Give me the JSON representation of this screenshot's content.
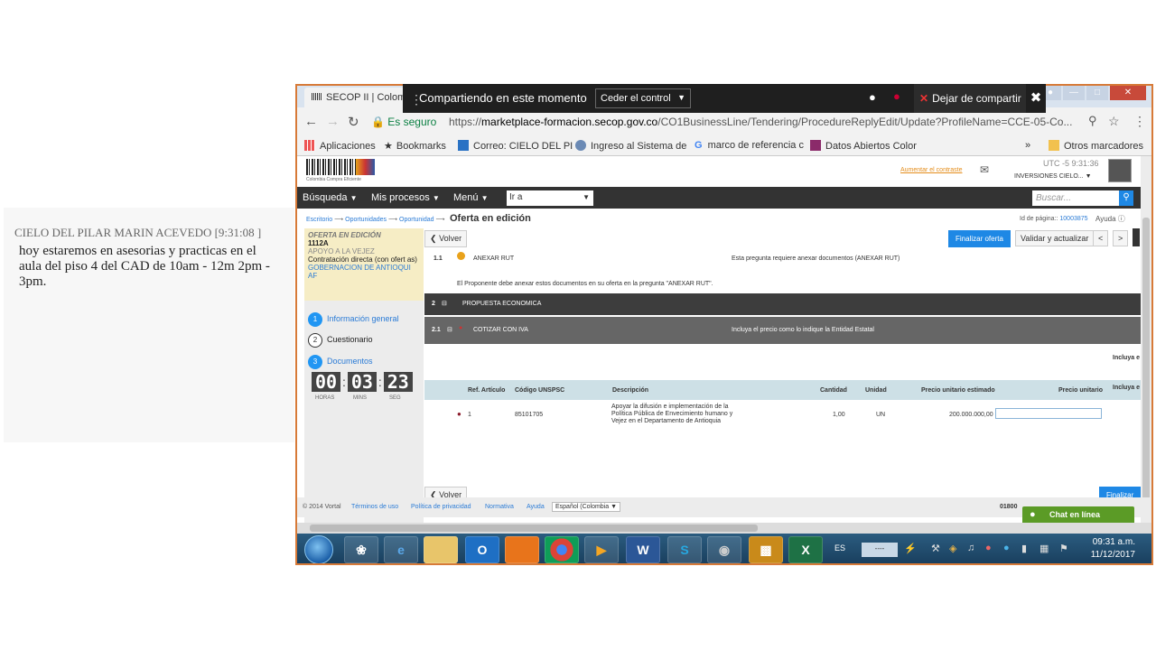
{
  "chat": {
    "sender": "CIELO DEL PILAR MARIN ACEVEDO [9:31:08 ]",
    "message": "hoy  estaremos en asesorias y practicas en el aula del piso 4 del CAD de 10am - 12m 2pm - 3pm."
  },
  "browser": {
    "tab_title": "SECOP II | Colomb",
    "secure_label": "Es seguro",
    "url_prefix": "https://",
    "url_domain": "marketplace-formacion.secop.gov.co",
    "url_path": "/CO1BusinessLine/Tendering/ProcedureReplyEdit/Update?ProfileName=CCE-05-Co...",
    "bookmarks": [
      "Aplicaciones",
      "Bookmarks",
      "Correo: CIELO DEL PI",
      "Ingreso al Sistema de",
      "marco de referencia c",
      "Datos Abiertos Color",
      "»",
      "Otros marcadores"
    ]
  },
  "sharebar": {
    "status": "Compartiendo en este momento",
    "control_option": "Ceder el control",
    "stop_label": "Dejar de compartir"
  },
  "header": {
    "brand_text": "Colombia Compra Eficiente",
    "contrast_link": "Aumentar el contraste",
    "utc": "UTC -5 9:31:36",
    "company": "INVERSIONES CIELO...",
    "menu": [
      "Búsqueda",
      "Mis procesos",
      "Menú"
    ],
    "goto_value": "Ir a",
    "search_placeholder": "Buscar..."
  },
  "breadcrumb": {
    "items": [
      "Escritorio",
      "Oportunidades",
      "Oportunidad"
    ],
    "current": "Oferta en edición",
    "page_id_label": "Id de página::",
    "page_id_value": "10003875",
    "help": "Ayuda"
  },
  "offer": {
    "status": "OFERTA EN EDICIÓN",
    "code": "1112A",
    "title": "APOYO A LA VEJEZ",
    "type": "Contratación directa (con ofert as)",
    "entity": "GOBERNACION DE ANTIOQUI AF"
  },
  "steps": [
    {
      "num": "1",
      "label": "Información general"
    },
    {
      "num": "2",
      "label": "Cuestionario"
    },
    {
      "num": "3",
      "label": "Documentos"
    }
  ],
  "timer": {
    "hours": "00",
    "mins": "03",
    "secs": "23",
    "hours_label": "HORAS",
    "mins_label": "MINS",
    "secs_label": "SEG"
  },
  "main": {
    "back_label": "Volver",
    "finalize_label": "Finalizar oferta",
    "validate_label": "Validar y actualizar",
    "prev": "<",
    "next": ">",
    "q11_num": "1.1",
    "q11_title": "ANEXAR RUT",
    "q11_note": "Esta pregunta requiere anexar documentos (ANEXAR RUT)",
    "q11_info": "El Proponente debe anexar estos documentos en su oferta en la pregunta \"ANEXAR RUT\".",
    "s2_num": "2",
    "s2_title": "PROPUESTA ECONOMICA",
    "s21_num": "2.1",
    "s21_title": "COTIZAR CON IVA",
    "s21_note": "Incluya el precio como lo indique la Entidad Estatal",
    "incluya_1": "Incluya e",
    "incluya_2": "Incluya e",
    "columns": [
      "Ref. Artículo",
      "Código UNSPSC",
      "Descripción",
      "Cantidad",
      "Unidad",
      "Precio unitario estimado",
      "Precio unitario"
    ],
    "row": {
      "ref": "1",
      "code": "85101705",
      "desc1": "Apoyar la difusión e implementación de la",
      "desc2": "Política Pública de Envecimiento humano y",
      "desc3": "Vejez en el Departamento de Antioquia",
      "qty": "1,00",
      "unit": "UN",
      "est_price": "200.000.000,00"
    },
    "bottom_back": "Volver",
    "bottom_finalize": "Finalizar"
  },
  "footer": {
    "copyright": "© 2014 Vortal",
    "links": [
      "Términos de uso",
      "Política de privacidad",
      "Normativa",
      "Ayuda"
    ],
    "language": "Español (Colombia",
    "phone_partial": "01800",
    "chat_label": "Chat en línea"
  },
  "taskbar": {
    "lang": "ES",
    "box": "----",
    "time": "09:31 a.m.",
    "date": "11/12/2017"
  }
}
